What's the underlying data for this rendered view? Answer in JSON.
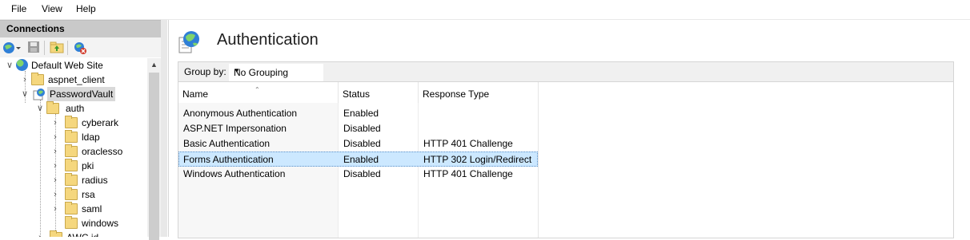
{
  "menu": {
    "file": "File",
    "view": "View",
    "help": "Help"
  },
  "connections": {
    "title": "Connections",
    "tree": {
      "default_site": "Default Web Site",
      "aspnet_client": "aspnet_client",
      "password_vault": "PasswordVault",
      "auth": "auth",
      "children": [
        "cyberark",
        "ldap",
        "oraclesso",
        "pki",
        "radius",
        "rsa",
        "saml",
        "windows"
      ],
      "partial_next": "AWC id"
    }
  },
  "main": {
    "title": "Authentication",
    "group_by_label": "Group by:",
    "group_by_value": "No Grouping",
    "columns": {
      "name": "Name",
      "status": "Status",
      "response_type": "Response Type"
    },
    "rows": [
      {
        "name": "Anonymous Authentication",
        "status": "Enabled",
        "response_type": ""
      },
      {
        "name": "ASP.NET Impersonation",
        "status": "Disabled",
        "response_type": ""
      },
      {
        "name": "Basic Authentication",
        "status": "Disabled",
        "response_type": "HTTP 401 Challenge"
      },
      {
        "name": "Forms Authentication",
        "status": "Enabled",
        "response_type": "HTTP 302 Login/Redirect"
      },
      {
        "name": "Windows Authentication",
        "status": "Disabled",
        "response_type": "HTTP 401 Challenge"
      }
    ],
    "selected_row": "Forms Authentication"
  },
  "colors": {
    "selection": "#cce8ff",
    "pane_header": "#c9c9c9",
    "tree_selected": "#d9d9d9"
  }
}
